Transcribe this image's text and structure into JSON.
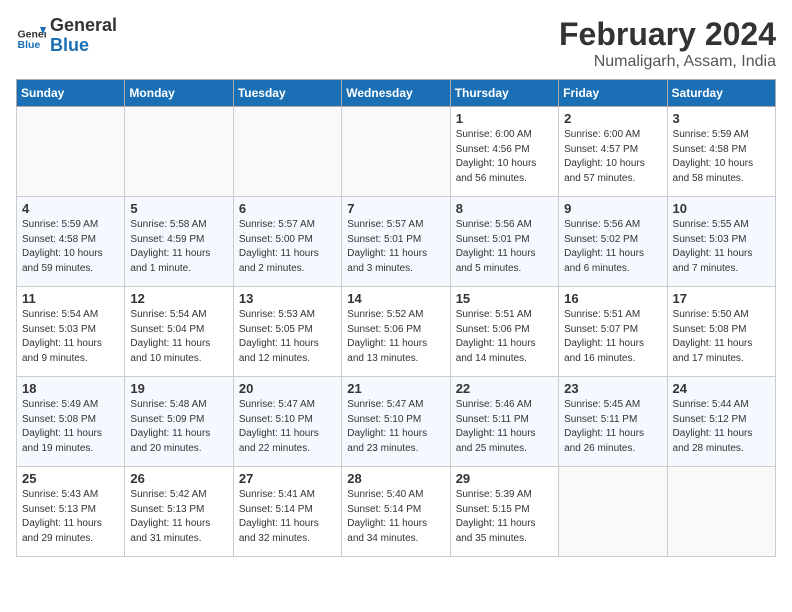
{
  "header": {
    "logo_line1": "General",
    "logo_line2": "Blue",
    "month": "February 2024",
    "location": "Numaligarh, Assam, India"
  },
  "days_of_week": [
    "Sunday",
    "Monday",
    "Tuesday",
    "Wednesday",
    "Thursday",
    "Friday",
    "Saturday"
  ],
  "weeks": [
    [
      {
        "day": "",
        "info": ""
      },
      {
        "day": "",
        "info": ""
      },
      {
        "day": "",
        "info": ""
      },
      {
        "day": "",
        "info": ""
      },
      {
        "day": "1",
        "info": "Sunrise: 6:00 AM\nSunset: 4:56 PM\nDaylight: 10 hours\nand 56 minutes."
      },
      {
        "day": "2",
        "info": "Sunrise: 6:00 AM\nSunset: 4:57 PM\nDaylight: 10 hours\nand 57 minutes."
      },
      {
        "day": "3",
        "info": "Sunrise: 5:59 AM\nSunset: 4:58 PM\nDaylight: 10 hours\nand 58 minutes."
      }
    ],
    [
      {
        "day": "4",
        "info": "Sunrise: 5:59 AM\nSunset: 4:58 PM\nDaylight: 10 hours\nand 59 minutes."
      },
      {
        "day": "5",
        "info": "Sunrise: 5:58 AM\nSunset: 4:59 PM\nDaylight: 11 hours\nand 1 minute."
      },
      {
        "day": "6",
        "info": "Sunrise: 5:57 AM\nSunset: 5:00 PM\nDaylight: 11 hours\nand 2 minutes."
      },
      {
        "day": "7",
        "info": "Sunrise: 5:57 AM\nSunset: 5:01 PM\nDaylight: 11 hours\nand 3 minutes."
      },
      {
        "day": "8",
        "info": "Sunrise: 5:56 AM\nSunset: 5:01 PM\nDaylight: 11 hours\nand 5 minutes."
      },
      {
        "day": "9",
        "info": "Sunrise: 5:56 AM\nSunset: 5:02 PM\nDaylight: 11 hours\nand 6 minutes."
      },
      {
        "day": "10",
        "info": "Sunrise: 5:55 AM\nSunset: 5:03 PM\nDaylight: 11 hours\nand 7 minutes."
      }
    ],
    [
      {
        "day": "11",
        "info": "Sunrise: 5:54 AM\nSunset: 5:03 PM\nDaylight: 11 hours\nand 9 minutes."
      },
      {
        "day": "12",
        "info": "Sunrise: 5:54 AM\nSunset: 5:04 PM\nDaylight: 11 hours\nand 10 minutes."
      },
      {
        "day": "13",
        "info": "Sunrise: 5:53 AM\nSunset: 5:05 PM\nDaylight: 11 hours\nand 12 minutes."
      },
      {
        "day": "14",
        "info": "Sunrise: 5:52 AM\nSunset: 5:06 PM\nDaylight: 11 hours\nand 13 minutes."
      },
      {
        "day": "15",
        "info": "Sunrise: 5:51 AM\nSunset: 5:06 PM\nDaylight: 11 hours\nand 14 minutes."
      },
      {
        "day": "16",
        "info": "Sunrise: 5:51 AM\nSunset: 5:07 PM\nDaylight: 11 hours\nand 16 minutes."
      },
      {
        "day": "17",
        "info": "Sunrise: 5:50 AM\nSunset: 5:08 PM\nDaylight: 11 hours\nand 17 minutes."
      }
    ],
    [
      {
        "day": "18",
        "info": "Sunrise: 5:49 AM\nSunset: 5:08 PM\nDaylight: 11 hours\nand 19 minutes."
      },
      {
        "day": "19",
        "info": "Sunrise: 5:48 AM\nSunset: 5:09 PM\nDaylight: 11 hours\nand 20 minutes."
      },
      {
        "day": "20",
        "info": "Sunrise: 5:47 AM\nSunset: 5:10 PM\nDaylight: 11 hours\nand 22 minutes."
      },
      {
        "day": "21",
        "info": "Sunrise: 5:47 AM\nSunset: 5:10 PM\nDaylight: 11 hours\nand 23 minutes."
      },
      {
        "day": "22",
        "info": "Sunrise: 5:46 AM\nSunset: 5:11 PM\nDaylight: 11 hours\nand 25 minutes."
      },
      {
        "day": "23",
        "info": "Sunrise: 5:45 AM\nSunset: 5:11 PM\nDaylight: 11 hours\nand 26 minutes."
      },
      {
        "day": "24",
        "info": "Sunrise: 5:44 AM\nSunset: 5:12 PM\nDaylight: 11 hours\nand 28 minutes."
      }
    ],
    [
      {
        "day": "25",
        "info": "Sunrise: 5:43 AM\nSunset: 5:13 PM\nDaylight: 11 hours\nand 29 minutes."
      },
      {
        "day": "26",
        "info": "Sunrise: 5:42 AM\nSunset: 5:13 PM\nDaylight: 11 hours\nand 31 minutes."
      },
      {
        "day": "27",
        "info": "Sunrise: 5:41 AM\nSunset: 5:14 PM\nDaylight: 11 hours\nand 32 minutes."
      },
      {
        "day": "28",
        "info": "Sunrise: 5:40 AM\nSunset: 5:14 PM\nDaylight: 11 hours\nand 34 minutes."
      },
      {
        "day": "29",
        "info": "Sunrise: 5:39 AM\nSunset: 5:15 PM\nDaylight: 11 hours\nand 35 minutes."
      },
      {
        "day": "",
        "info": ""
      },
      {
        "day": "",
        "info": ""
      }
    ]
  ]
}
